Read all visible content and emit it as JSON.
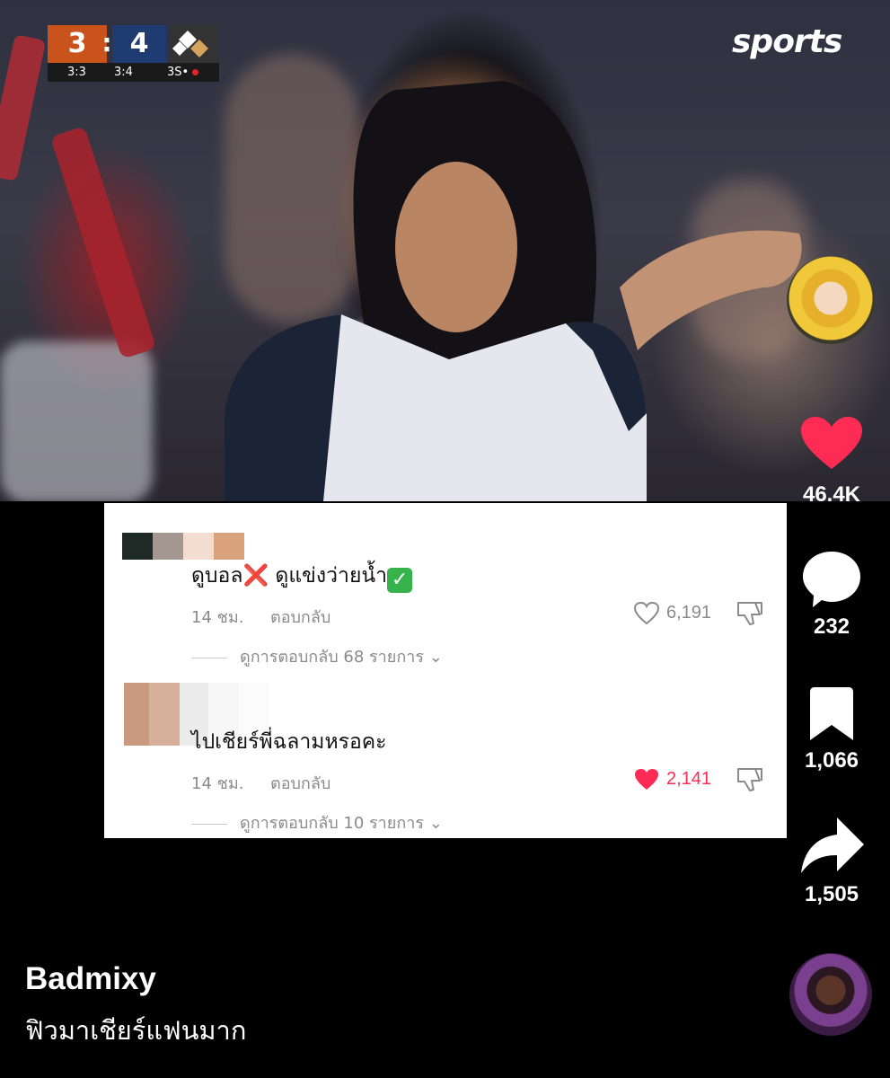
{
  "scoreboard": {
    "home_score": "3",
    "separator": ":",
    "away_score": "4",
    "sub_left": "3:3",
    "sub_mid": "3:4",
    "sub_right": "3S•"
  },
  "brand": "sports",
  "rail": {
    "likes": "46.4K",
    "comments": "232",
    "saves": "1,066",
    "shares": "1,505"
  },
  "comments": [
    {
      "text_part1": "ดูบอล",
      "emoji1": "❌",
      "text_part2": " ดูแข่งว่ายน้ำ",
      "emoji2": "✓",
      "time": "14 ชม.",
      "reply_label": "ตอบกลับ",
      "likes": "6,191",
      "liked": false,
      "view_replies": "ดูการตอบกลับ 68 รายการ"
    },
    {
      "text": "ไปเชียร์พี่ฉลามหรอคะ",
      "time": "14 ชม.",
      "reply_label": "ตอบกลับ",
      "likes": "2,141",
      "liked": true,
      "view_replies": "ดูการตอบกลับ 10 รายการ"
    }
  ],
  "author": "Badmixy",
  "caption": "ฟิวมาเชียร์แฟนมาก",
  "colors": {
    "like_red": "#fe2c55",
    "home_team": "#c9531b",
    "away_team": "#1f3c72"
  },
  "icons": [
    "heart-icon",
    "comment-bubble-icon",
    "bookmark-icon",
    "share-arrow-icon",
    "chevron-down-icon",
    "dislike-icon"
  ]
}
